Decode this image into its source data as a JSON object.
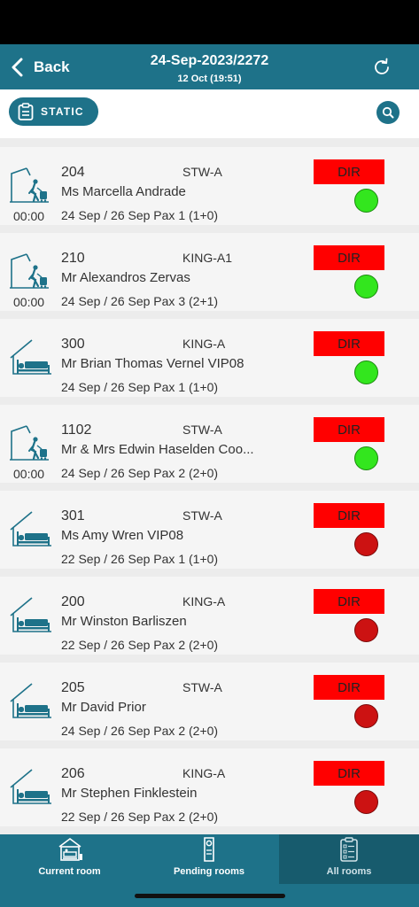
{
  "header": {
    "back_label": "Back",
    "title": "24-Sep-2023/2272",
    "subtitle": "12 Oct (19:51)"
  },
  "toolbar": {
    "static_label": "STATIC"
  },
  "colors": {
    "brand": "#1e7289",
    "dir_badge": "#ff0000",
    "status_green": "#33e61e",
    "status_red": "#cc1212"
  },
  "rooms": [
    {
      "room": "204",
      "type": "STW-A",
      "guest": "Ms Marcella Andrade",
      "dates": "24 Sep / 26 Sep Pax  1 (1+0)",
      "time": "00:00",
      "badge": "DIR",
      "icon": "arrival-luggage-icon",
      "status": "green"
    },
    {
      "room": "210",
      "type": "KING-A1",
      "guest": "Mr Alexandros Zervas",
      "dates": "24 Sep / 26 Sep Pax  3 (2+1)",
      "time": "00:00",
      "badge": "DIR",
      "icon": "arrival-luggage-icon",
      "status": "green"
    },
    {
      "room": "300",
      "type": "KING-A",
      "guest": "Mr Brian Thomas Vernel VIP08",
      "dates": "24 Sep / 26 Sep Pax  1 (1+0)",
      "time": "",
      "badge": "DIR",
      "icon": "occupied-bed-icon",
      "status": "green"
    },
    {
      "room": "1102",
      "type": "STW-A",
      "guest": "Mr & Mrs Edwin Haselden Coo...",
      "dates": "24 Sep / 26 Sep Pax  2 (2+0)",
      "time": "00:00",
      "badge": "DIR",
      "icon": "arrival-luggage-icon",
      "status": "green"
    },
    {
      "room": "301",
      "type": "STW-A",
      "guest": "Ms Amy Wren VIP08",
      "dates": "22 Sep / 26 Sep Pax  1 (1+0)",
      "time": "",
      "badge": "DIR",
      "icon": "occupied-bed-icon",
      "status": "red"
    },
    {
      "room": "200",
      "type": "KING-A",
      "guest": "Mr Winston Barliszen",
      "dates": "22 Sep / 26 Sep Pax  2 (2+0)",
      "time": "",
      "badge": "DIR",
      "icon": "occupied-bed-icon",
      "status": "red"
    },
    {
      "room": "205",
      "type": "STW-A",
      "guest": "Mr David Prior",
      "dates": "24 Sep / 26 Sep Pax  2 (2+0)",
      "time": "",
      "badge": "DIR",
      "icon": "occupied-bed-icon",
      "status": "red"
    },
    {
      "room": "206",
      "type": "KING-A",
      "guest": "Mr Stephen Finklestein",
      "dates": "22 Sep / 26 Sep Pax  2 (2+0)",
      "time": "",
      "badge": "DIR",
      "icon": "occupied-bed-icon",
      "status": "red"
    }
  ],
  "tabs": [
    {
      "label": "Current room",
      "icon": "bed-building-icon",
      "active": false
    },
    {
      "label": "Pending rooms",
      "icon": "door-hanger-icon",
      "active": false
    },
    {
      "label": "All rooms",
      "icon": "clipboard-list-icon",
      "active": true
    }
  ]
}
